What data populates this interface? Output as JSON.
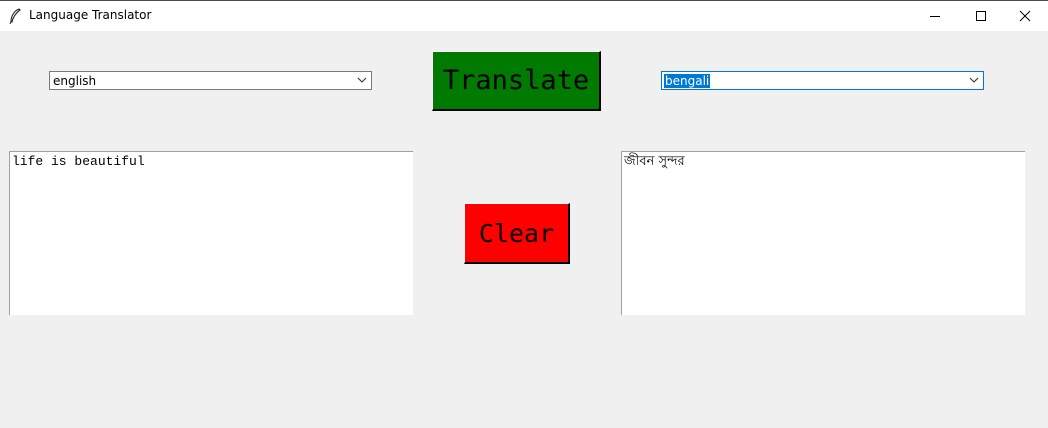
{
  "window": {
    "title": "Language Translator",
    "controls": [
      "minimize-icon",
      "maximize-icon",
      "close-icon"
    ]
  },
  "source_language": {
    "selected": "english"
  },
  "target_language": {
    "selected": "bengali"
  },
  "buttons": {
    "translate_label": "Translate",
    "clear_label": "Clear"
  },
  "input_text": "life is beautiful",
  "output_text": "জীবন সুন্দর",
  "colors": {
    "translate_bg": "#007a00",
    "clear_bg": "#ff0000",
    "window_bg": "#f0f0f0",
    "selection": "#0078d7"
  }
}
